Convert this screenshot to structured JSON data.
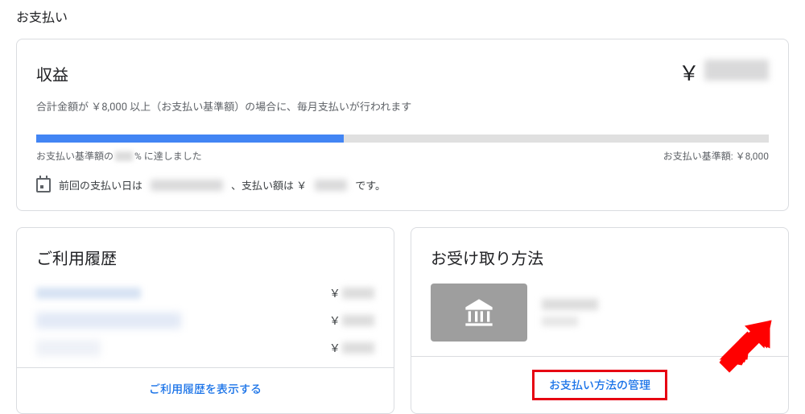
{
  "page_title": "お支払い",
  "earnings": {
    "title": "収益",
    "currency_symbol": "￥",
    "threshold_note": "合計金額が ￥8,000 以上（お支払い基準額）の場合に、毎月支払いが行われます",
    "progress_percent": 42,
    "progress_left_prefix": "お支払い基準額の",
    "progress_left_suffix": "% に達しました",
    "progress_right": "お支払い基準額: ￥8,000",
    "last_pay_prefix": "前回の支払い日は",
    "last_pay_mid": "、支払い額は ￥",
    "last_pay_suffix": "です。"
  },
  "history": {
    "title": "ご利用履歴",
    "yen": "￥",
    "view_link": "ご利用履歴を表示する"
  },
  "payment_method": {
    "title": "お受け取り方法",
    "manage_link": "お支払い方法の管理"
  },
  "colors": {
    "link": "#1a73e8",
    "highlight": "#e60012",
    "progress": "#4285f4"
  }
}
